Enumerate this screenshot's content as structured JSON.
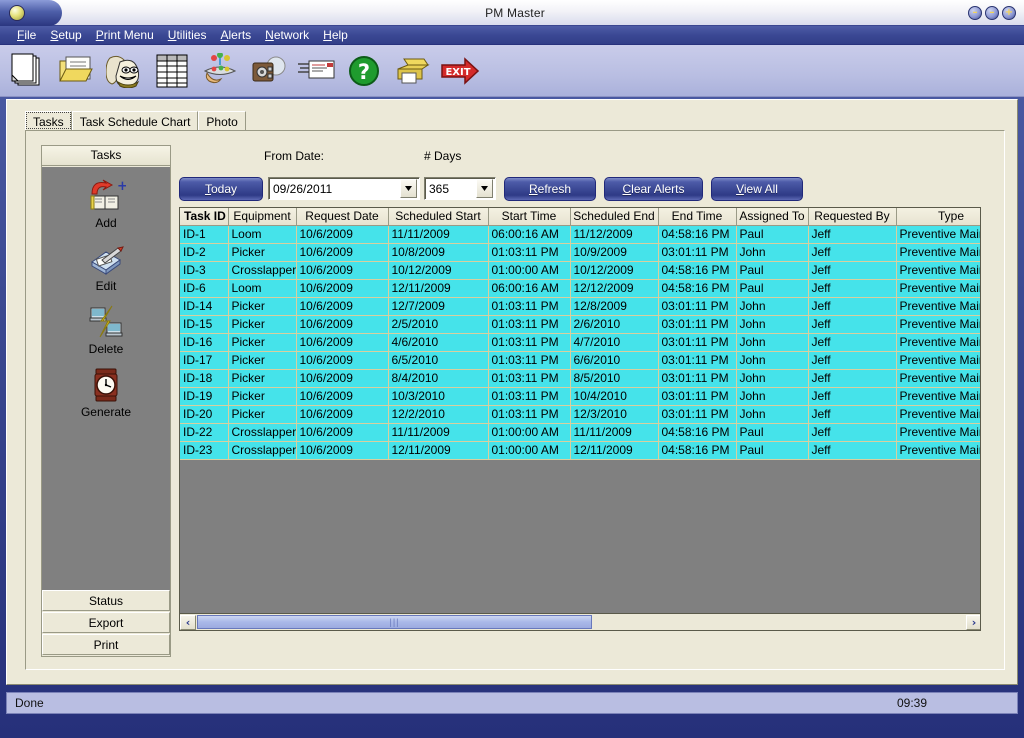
{
  "window": {
    "title": "PM Master",
    "controls": [
      {
        "name": "minimize",
        "glyph": "–"
      },
      {
        "name": "maximize",
        "glyph": "–"
      },
      {
        "name": "close",
        "glyph": "+"
      }
    ]
  },
  "menubar": {
    "items": [
      {
        "label": "File",
        "accel": "F"
      },
      {
        "label": "Setup",
        "accel": "S"
      },
      {
        "label": "Print Menu",
        "accel": "P"
      },
      {
        "label": "Utilities",
        "accel": "U"
      },
      {
        "label": "Alerts",
        "accel": "A"
      },
      {
        "label": "Network",
        "accel": "N"
      },
      {
        "label": "Help",
        "accel": "H"
      }
    ]
  },
  "toolbar": {
    "buttons": [
      {
        "name": "new-document-icon",
        "title": "New"
      },
      {
        "name": "open-folder-icon",
        "title": "Open"
      },
      {
        "name": "scroll-mask-icon",
        "title": "History"
      },
      {
        "name": "grid-table-icon",
        "title": "Table"
      },
      {
        "name": "serving-tray-icon",
        "title": "Service"
      },
      {
        "name": "camera-icon",
        "title": "Photo"
      },
      {
        "name": "email-envelope-icon",
        "title": "Mail"
      },
      {
        "name": "help-question-icon",
        "title": "Help"
      },
      {
        "name": "printer-icon",
        "title": "Print"
      },
      {
        "name": "exit-arrow-icon",
        "title": "EXIT"
      }
    ]
  },
  "tabs": [
    {
      "label": "Tasks",
      "selected": true
    },
    {
      "label": "Task Schedule Chart",
      "selected": false
    },
    {
      "label": "Photo",
      "selected": false
    }
  ],
  "sidebar": {
    "header": "Tasks",
    "actions": [
      {
        "label": "Add",
        "icon": "add-book-icon"
      },
      {
        "label": "Edit",
        "icon": "edit-pencil-icon"
      },
      {
        "label": "Delete",
        "icon": "delete-network-icon"
      },
      {
        "label": "Generate",
        "icon": "clock-icon"
      }
    ],
    "footer_buttons": [
      {
        "label": "Status"
      },
      {
        "label": "Export"
      },
      {
        "label": "Print"
      }
    ]
  },
  "filters": {
    "from_date_label": "From Date:",
    "days_label": "# Days",
    "today_button": {
      "label": "Today",
      "accel": "T"
    },
    "from_date_value": "09/26/2011",
    "days_value": "365",
    "refresh_button": {
      "label": "Refresh",
      "accel": "R"
    },
    "clear_alerts_button": {
      "label": "Clear Alerts",
      "accel": "C"
    },
    "view_all_button": {
      "label": "View All",
      "accel": "V"
    }
  },
  "grid": {
    "columns": [
      "Task ID",
      "Equipment",
      "Request Date",
      "Scheduled Start",
      "Start Time",
      "Scheduled End",
      "End Time",
      "Assigned To",
      "Requested By",
      "Type"
    ],
    "rows": [
      [
        "ID-1",
        "Loom",
        "10/6/2009",
        "11/11/2009",
        "06:00:16 AM",
        "11/12/2009",
        "04:58:16 PM",
        "Paul",
        "Jeff",
        "Preventive Maintenance"
      ],
      [
        "ID-2",
        "Picker",
        "10/6/2009",
        "10/8/2009",
        "01:03:11 PM",
        "10/9/2009",
        "03:01:11 PM",
        "John",
        "Jeff",
        "Preventive Maintenance"
      ],
      [
        "ID-3",
        "Crosslapper",
        "10/6/2009",
        "10/12/2009",
        "01:00:00 AM",
        "10/12/2009",
        "04:58:16 PM",
        "Paul",
        "Jeff",
        "Preventive Maintenance"
      ],
      [
        "ID-6",
        "Loom",
        "10/6/2009",
        "12/11/2009",
        "06:00:16 AM",
        "12/12/2009",
        "04:58:16 PM",
        "Paul",
        "Jeff",
        "Preventive Maintenance"
      ],
      [
        "ID-14",
        "Picker",
        "10/6/2009",
        "12/7/2009",
        "01:03:11 PM",
        "12/8/2009",
        "03:01:11 PM",
        "John",
        "Jeff",
        "Preventive Maintenance"
      ],
      [
        "ID-15",
        "Picker",
        "10/6/2009",
        "2/5/2010",
        "01:03:11 PM",
        "2/6/2010",
        "03:01:11 PM",
        "John",
        "Jeff",
        "Preventive Maintenance"
      ],
      [
        "ID-16",
        "Picker",
        "10/6/2009",
        "4/6/2010",
        "01:03:11 PM",
        "4/7/2010",
        "03:01:11 PM",
        "John",
        "Jeff",
        "Preventive Maintenance"
      ],
      [
        "ID-17",
        "Picker",
        "10/6/2009",
        "6/5/2010",
        "01:03:11 PM",
        "6/6/2010",
        "03:01:11 PM",
        "John",
        "Jeff",
        "Preventive Maintenance"
      ],
      [
        "ID-18",
        "Picker",
        "10/6/2009",
        "8/4/2010",
        "01:03:11 PM",
        "8/5/2010",
        "03:01:11 PM",
        "John",
        "Jeff",
        "Preventive Maintenance"
      ],
      [
        "ID-19",
        "Picker",
        "10/6/2009",
        "10/3/2010",
        "01:03:11 PM",
        "10/4/2010",
        "03:01:11 PM",
        "John",
        "Jeff",
        "Preventive Maintenance"
      ],
      [
        "ID-20",
        "Picker",
        "10/6/2009",
        "12/2/2010",
        "01:03:11 PM",
        "12/3/2010",
        "03:01:11 PM",
        "John",
        "Jeff",
        "Preventive Maintenance"
      ],
      [
        "ID-22",
        "Crosslapper",
        "10/6/2009",
        "11/11/2009",
        "01:00:00 AM",
        "11/11/2009",
        "04:58:16 PM",
        "Paul",
        "Jeff",
        "Preventive Maintenance"
      ],
      [
        "ID-23",
        "Crosslapper",
        "10/6/2009",
        "12/11/2009",
        "01:00:00 AM",
        "12/11/2009",
        "04:58:16 PM",
        "Paul",
        "Jeff",
        "Preventive Maintenance"
      ]
    ]
  },
  "scrollbar": {
    "left_arrow": "‹",
    "right_arrow": "›",
    "grip": "|||"
  },
  "statusbar": {
    "message": "Done",
    "time": "09:39"
  },
  "colors": {
    "row_cyan": "#45e3ea",
    "grid_line": "#d8cf9e",
    "panel_beige": "#ece9d8",
    "sidebar_gray": "#808080",
    "accent_blue": "#3b4894"
  }
}
